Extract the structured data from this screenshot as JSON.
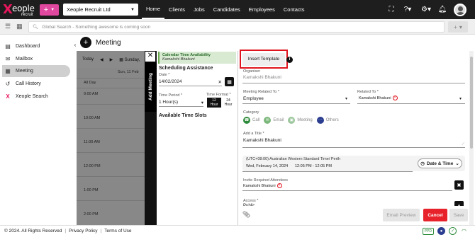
{
  "brand": {
    "logo_word": "eople",
    "logo_sub": "recruit",
    "accent": "#e8175d"
  },
  "topbar": {
    "org": "Xeople Recruit Ltd",
    "nav": [
      "Home",
      "Clients",
      "Jobs",
      "Candidates",
      "Employees",
      "Contacts"
    ],
    "active_nav": "Home"
  },
  "search": {
    "placeholder": "Global Search - Something awesome is coming soon"
  },
  "sidebar": {
    "items": [
      {
        "label": "Dashboard",
        "icon": "document-icon"
      },
      {
        "label": "Mailbox",
        "icon": "mail-icon"
      },
      {
        "label": "Meeting",
        "icon": "calendar-icon",
        "active": true
      },
      {
        "label": "Call History",
        "icon": "history-icon"
      },
      {
        "label": "Xeople Search",
        "icon": "xeople-logo-icon"
      }
    ]
  },
  "page": {
    "title": "Meeting"
  },
  "calendar": {
    "today": "Today",
    "view": "Sunday,",
    "date_header": "Sun, 11 Feb",
    "all_day": "All Day",
    "times": [
      "9:00 AM",
      "10:00 AM",
      "11:00 AM",
      "12:00 PM",
      "1:00 PM",
      "2:00 PM"
    ]
  },
  "add_meeting_tab": "Add Meeting",
  "availability": {
    "card_title": "Calendar Time Availability",
    "card_name": "Kamakshi Bhakuni",
    "section_title": "Scheduling Assistance",
    "date_label": "Date *",
    "date_value": "14/02/2024",
    "period_label": "Time Period *",
    "period_value": "1 Hour(s)",
    "format_label": "Time Format *",
    "format_12": [
      "12",
      "Hour"
    ],
    "format_24": [
      "24",
      "Hour"
    ],
    "slots_title": "Available Time Slots"
  },
  "form": {
    "insert_template": "Insert Template",
    "organiser_label": "Organiser",
    "organiser_value": "Kamakshi Bhakuni",
    "related_to_label": "Meeting Related To *",
    "related_to_value": "Employee",
    "related_label": "Related To *",
    "related_value": "Kamakshi Bhakuni",
    "category_label": "Category",
    "categories": [
      "Call",
      "Email",
      "Meeting",
      "Others"
    ],
    "title_label": "Add a Title *",
    "title_value": "Kamakshi Bhakuni",
    "timezone": "(UTC+08:00) Australian Western Standard Time/ Perth",
    "date_text": "Wed, February 14, 2024",
    "time_text": "12:05 PM - 12:05 PM",
    "date_time_button": "Date & Time",
    "attendees_label": "Invite Required Attendees",
    "attendee_value": "Kamakshi Bhakuni",
    "access_label": "Access *",
    "access_value": "Public",
    "email_preview": "Email Preview",
    "cancel": "Cancel",
    "save": "Save"
  },
  "footer": {
    "copyright": "© 2024. All Rights Reserved",
    "privacy": "Privacy Policy",
    "terms": "Terms of Use",
    "ppd": "PPD"
  }
}
